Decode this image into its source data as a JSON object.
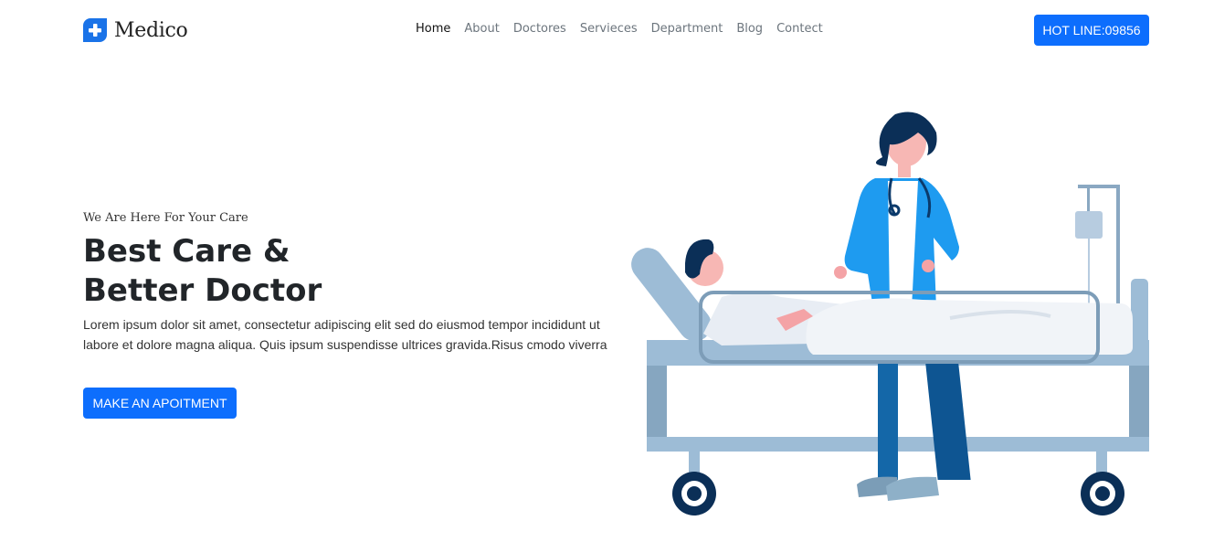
{
  "header": {
    "brand": "Medico",
    "logo_icon": "medical-cross-icon",
    "nav": [
      {
        "label": "Home",
        "active": true
      },
      {
        "label": "About",
        "active": false
      },
      {
        "label": "Doctores",
        "active": false
      },
      {
        "label": "Servieces",
        "active": false
      },
      {
        "label": "Department",
        "active": false
      },
      {
        "label": "Blog",
        "active": false
      },
      {
        "label": "Contect",
        "active": false
      }
    ],
    "hotline_label": "HOT LINE:09856"
  },
  "hero": {
    "eyebrow": "We Are Here For Your Care",
    "title_line1": "Best Care &",
    "title_line2": "Better Doctor",
    "description": "Lorem ipsum dolor sit amet, consectetur adipiscing elit sed do eiusmod tempor incididunt ut labore et dolore magna aliqua. Quis ipsum suspendisse ultrices gravida.Risus cmodo viverra",
    "cta_label": "MAKE AN APOITMENT"
  },
  "colors": {
    "accent": "#0d6efd",
    "doctor_coat": "#1e9bf0",
    "navy": "#0b3a6b",
    "bed": "#9dbcd6"
  }
}
